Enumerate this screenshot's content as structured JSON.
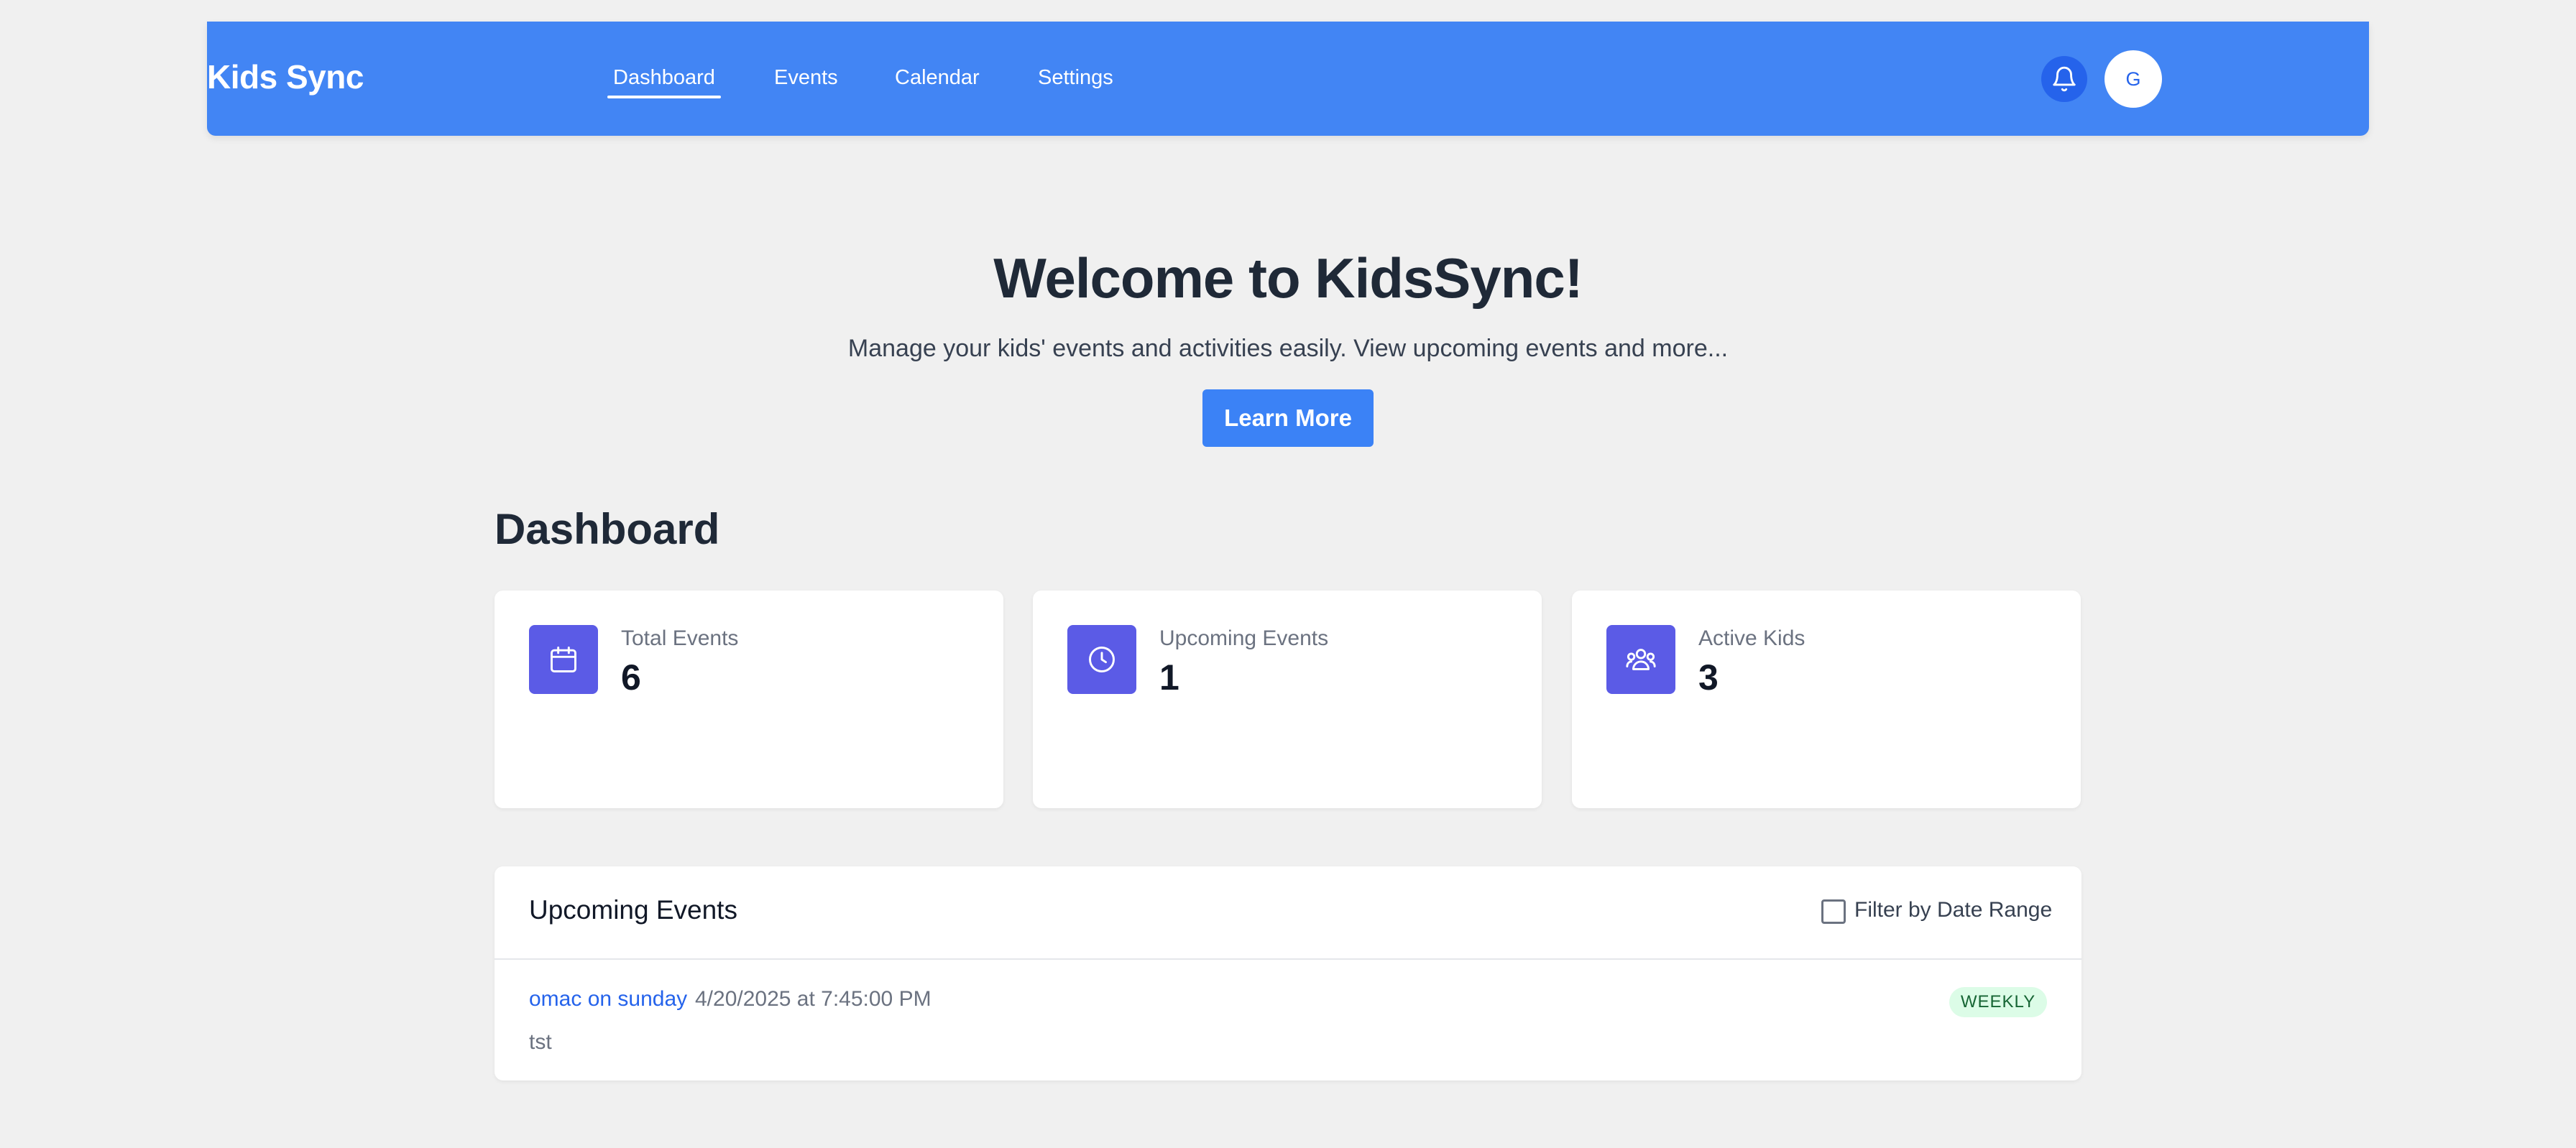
{
  "header": {
    "brand": "Kids Sync",
    "nav": [
      {
        "label": "Dashboard",
        "active": true
      },
      {
        "label": "Events",
        "active": false
      },
      {
        "label": "Calendar",
        "active": false
      },
      {
        "label": "Settings",
        "active": false
      }
    ],
    "avatar_initial": "G",
    "accent_color": "#4285f4"
  },
  "hero": {
    "title": "Welcome to KidsSync!",
    "subtitle": "Manage your kids' events and activities easily. View upcoming events and more...",
    "button_label": "Learn More"
  },
  "dashboard": {
    "title": "Dashboard",
    "stats": [
      {
        "label": "Total Events",
        "value": "6",
        "icon": "calendar-icon"
      },
      {
        "label": "Upcoming Events",
        "value": "1",
        "icon": "clock-icon"
      },
      {
        "label": "Active Kids",
        "value": "3",
        "icon": "users-icon"
      }
    ],
    "icon_color": "#5b5be6"
  },
  "upcoming": {
    "title": "Upcoming Events",
    "filter_label": "Filter by Date Range",
    "filter_checked": false,
    "events": [
      {
        "name": "omac on sunday",
        "datetime": "4/20/2025 at 7:45:00 PM",
        "description": "tst",
        "recurrence": "WEEKLY"
      }
    ]
  }
}
